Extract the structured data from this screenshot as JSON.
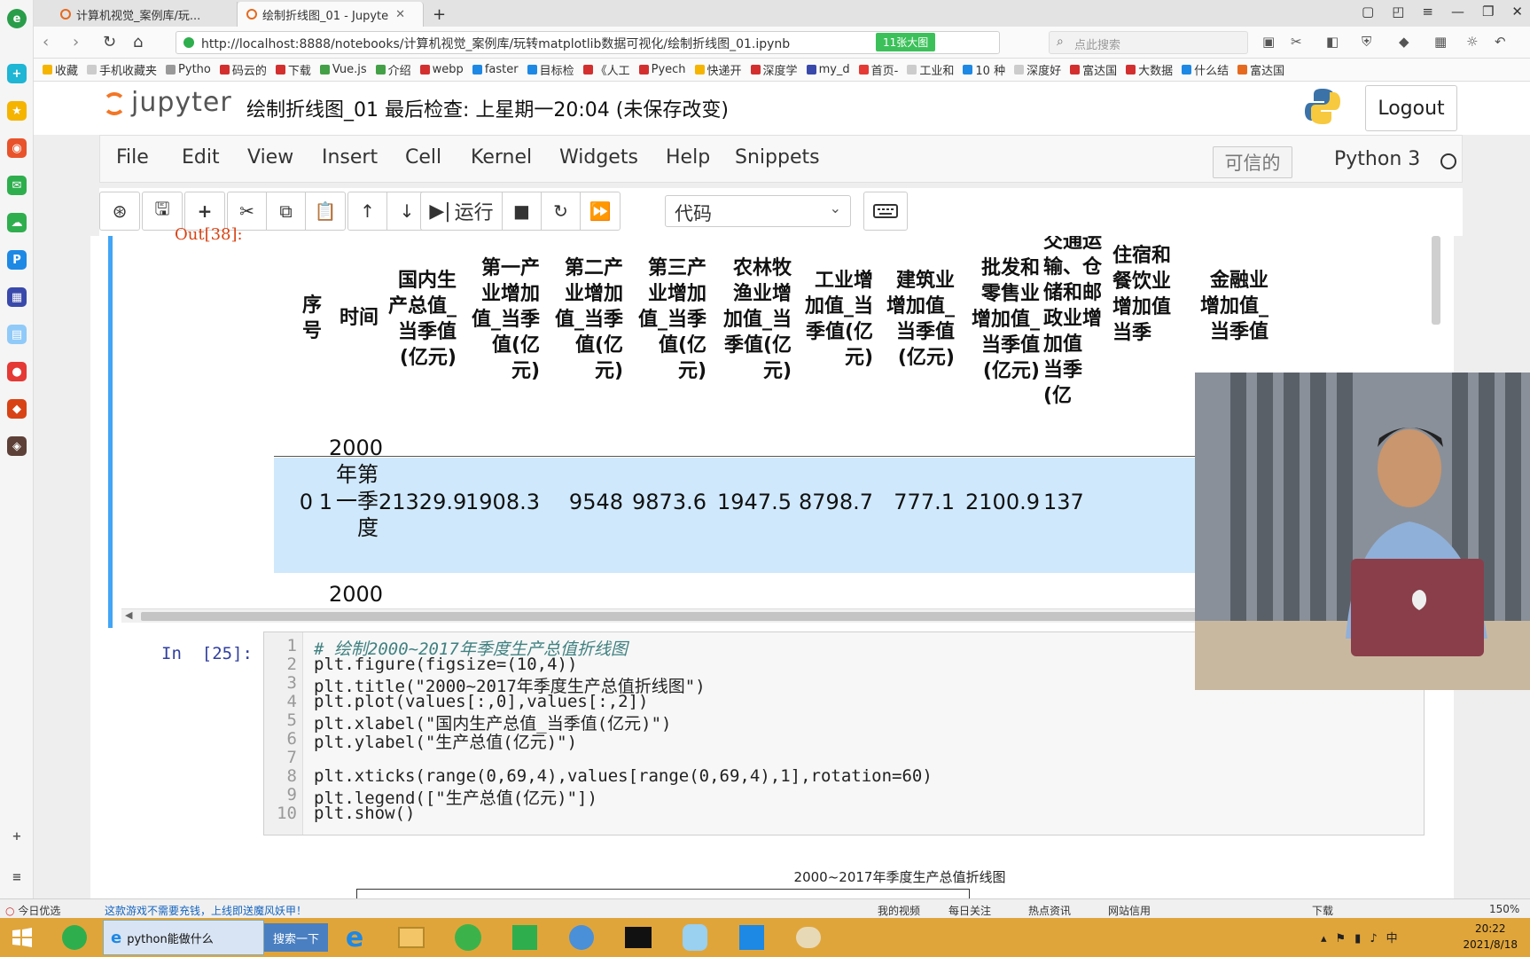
{
  "browser": {
    "tabs": [
      {
        "label": "计算机视觉_案例库/玩..."
      },
      {
        "label": "绘制折线图_01 - Jupyte"
      }
    ],
    "new_tab": "+",
    "url": "http://localhost:8888/notebooks/计算机视觉_案例库/玩转matplotlib数据可视化/绘制折线图_01.ipynb",
    "url_badge": "11张大图",
    "search_placeholder": "点此搜索",
    "bookmarks": [
      "收藏",
      "手机收藏夹",
      "Pytho",
      "码云的",
      "下载",
      "Vue.js",
      "介绍",
      "webp",
      "faster",
      "目标检",
      "《人工",
      "Pyech",
      "快递开",
      "深度学",
      "my_d",
      "首页-",
      "工业和",
      "10 种",
      "深度好",
      "富达国",
      "大数据",
      "什么结",
      "富达国"
    ]
  },
  "jupyter": {
    "logo": "jupyter",
    "notebook_title": "绘制折线图_01 最后检查: 上星期一20:04  (未保存改变)",
    "logout": "Logout",
    "menu": [
      "File",
      "Edit",
      "View",
      "Insert",
      "Cell",
      "Kernel",
      "Widgets",
      "Help",
      "Snippets"
    ],
    "trusted": "可信的",
    "kernel": "Python 3",
    "toolbar": {
      "run_label": "运行",
      "cell_type": "代码"
    }
  },
  "output_cell": {
    "prompt": "Out[38]:",
    "headers": [
      "序\n号",
      "时间",
      "国内生\n产总值_\n当季值\n(亿元)",
      "第一产\n业增加\n值_当季\n值(亿\n元)",
      "第二产\n业增加\n值_当季\n值(亿\n元)",
      "第三产\n业增加\n值_当季\n值(亿\n元)",
      "农林牧\n渔业增\n加值_当\n季值(亿\n元)",
      "工业增\n加值_当\n季值(亿\n元)",
      "建筑业\n增加值_\n当季值\n(亿元)",
      "批发和\n零售业\n增加值_\n当季值\n(亿元)",
      "交通运\n输、仓\n储和邮\n政业增\n加值\n当季\n(亿",
      "住宿和\n餐饮业\n增加值\n当季",
      "金融业\n增加值_\n当季值"
    ],
    "row0": {
      "index": "0",
      "seq": "1",
      "time": "2000\n年第\n一季\n度",
      "values": [
        "21329.9",
        "1908.3",
        "9548",
        "9873.6",
        "1947.5",
        "8798.7",
        "777.1",
        "2100.9",
        "137"
      ]
    },
    "row1_partial": "2000"
  },
  "code_cell": {
    "prompt": "In  [25]:",
    "line_numbers": [
      "1",
      "2",
      "3",
      "4",
      "5",
      "6",
      "7",
      "8",
      "9",
      "10"
    ],
    "lines": [
      "# 绘制2000~2017年季度生产总值折线图",
      "plt.figure(figsize=(10,4))",
      "plt.title(\"2000~2017年季度生产总值折线图\")",
      "plt.plot(values[:,0],values[:,2])",
      "plt.xlabel(\"国内生产总值_当季值(亿元)\")",
      "plt.ylabel(\"生产总值(亿元)\")",
      "",
      "plt.xticks(range(0,69,4),values[range(0,69,4),1],rotation=60)",
      "plt.legend([\"生产总值(亿元)\"])",
      "plt.show()"
    ]
  },
  "plot_output": {
    "title": "2000~2017年季度生产总值折线图"
  },
  "statusbar": {
    "left_items": [
      "今日优选",
      "这款游戏不需要充钱，上线即送魔风妖甲！"
    ],
    "right_items": [
      "我的视频",
      "每日关注",
      "热点资讯",
      "网站信用",
      "下载",
      "150%"
    ]
  },
  "taskbar": {
    "active_window": "python能做什么",
    "search_button": "搜索一下",
    "time": "20:22",
    "date": "2021/8/18"
  },
  "colors": {
    "jupyter_orange": "#f37626",
    "cell_selected_blue": "#42a5f5",
    "row_highlight": "#cfe8fc",
    "taskbar": "#e0a53a"
  }
}
